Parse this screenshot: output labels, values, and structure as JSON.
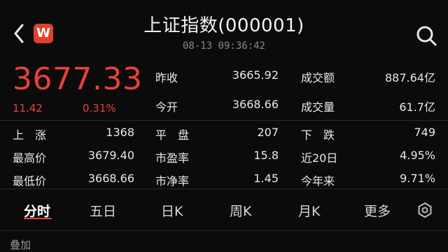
{
  "header": {
    "title": "上证指数(000001)",
    "datetime": "08-13 09:36:42",
    "app_badge": "W",
    "icons": {
      "back": "chevron-left-icon",
      "search": "search-icon"
    }
  },
  "quote": {
    "price": "3677.33",
    "change": "11.42",
    "change_pct": "0.31%",
    "up_color": "#e8413b"
  },
  "stats": {
    "prev_close": {
      "label": "昨收",
      "value": "3665.92"
    },
    "open": {
      "label": "今开",
      "value": "3668.66"
    },
    "turnover": {
      "label": "成交额",
      "value": "887.64亿"
    },
    "volume": {
      "label": "成交量",
      "value": "61.7亿"
    },
    "rise": {
      "label": "上　涨",
      "value": "1368"
    },
    "flat": {
      "label": "平　盘",
      "value": "207"
    },
    "fall": {
      "label": "下　跌",
      "value": "749"
    },
    "high": {
      "label": "最高价",
      "value": "3679.40"
    },
    "pe": {
      "label": "市盈率",
      "value": "15.8"
    },
    "d20": {
      "label": "近20日",
      "value": "4.95%"
    },
    "low": {
      "label": "最低价",
      "value": "3668.66"
    },
    "pb": {
      "label": "市净率",
      "value": "1.45"
    },
    "ytd": {
      "label": "今年来",
      "value": "9.71%"
    }
  },
  "tabs": [
    {
      "label": "分时"
    },
    {
      "label": "五日"
    },
    {
      "label": "日K"
    },
    {
      "label": "周K"
    },
    {
      "label": "月K"
    },
    {
      "label": "更多"
    }
  ],
  "overlay": {
    "label": "叠加"
  }
}
